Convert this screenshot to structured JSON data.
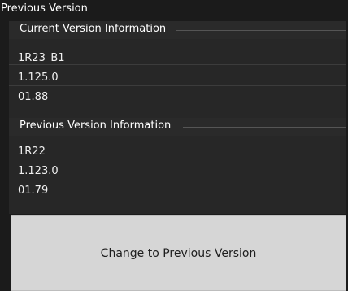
{
  "window": {
    "title": "Previous Version"
  },
  "current": {
    "heading": "Current Version Information",
    "values": [
      "1R23_B1",
      "1.125.0",
      "01.88"
    ]
  },
  "previous": {
    "heading": "Previous Version Information",
    "values": [
      "1R22",
      "1.123.0",
      "01.79"
    ]
  },
  "actions": {
    "change_label": "Change to Previous Version"
  }
}
